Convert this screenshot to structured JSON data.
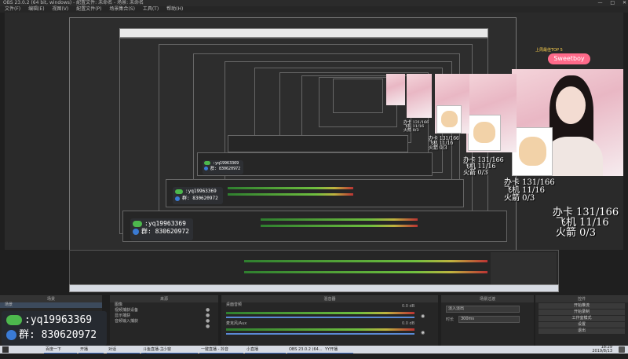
{
  "window": {
    "title": "OBS 23.0.2 (64 bit, windows) - 配置文件: 未命名 - 场景: 未命名",
    "controls": [
      "—",
      "□",
      "✕"
    ]
  },
  "menu": [
    "文件(F)",
    "编辑(E)",
    "视图(V)",
    "配置文件(P)",
    "场景集合(S)",
    "工具(T)",
    "帮助(H)"
  ],
  "overlay": {
    "qq_id": ":yq19963369",
    "qq_group": "群: 830620972",
    "stats": {
      "line1": "办卡 131/166",
      "line2": "飞机 11/16",
      "line3": "火箭 0/3"
    },
    "badge_text": "Sweetboy",
    "follow_text": "上周最佳TOP 5"
  },
  "docks": {
    "scenes": {
      "title": "场景",
      "items": [
        "场景"
      ]
    },
    "sources": {
      "title": "来源",
      "items": [
        "图像",
        "视频捕获设备",
        "显示捕获",
        "音频输入捕获"
      ]
    },
    "mixer": {
      "title": "混音器",
      "ch1": "桌面音频",
      "ch2": "麦克风/Aux",
      "db1": "0.0 dB",
      "db2": "0.0 dB"
    },
    "transitions": {
      "title": "场景过渡",
      "type": "淡入淡出",
      "duration_label": "时长",
      "duration_value": "300ms"
    },
    "controls": {
      "title": "控件",
      "buttons": [
        "开始推流",
        "开始录制",
        "工作室模式",
        "设置",
        "退出"
      ]
    }
  },
  "status": {
    "live": "LIVE: 00:00:00",
    "rec": "REC: 00:00:00",
    "cpu": "CPU: 3.7%, 60.00 fps"
  },
  "taskbar": {
    "items": [
      "百度一下",
      "开播",
      "对话",
      "斗鱼直播-主播",
      "小窗",
      "一键直播 - 抖音",
      "小直播",
      "OBS 23.0.2 (64...",
      "YY开播"
    ],
    "clock": "18:29",
    "date": "2019/8/13"
  }
}
